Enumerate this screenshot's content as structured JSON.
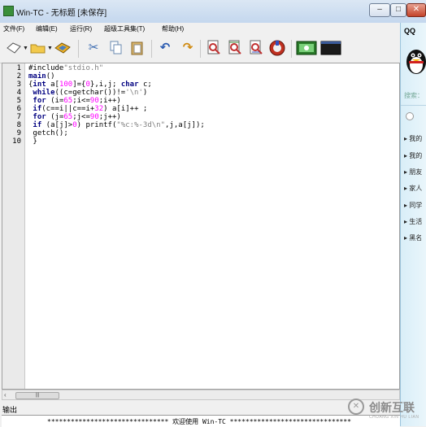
{
  "window": {
    "title": "Win-TC - 无标题 [未保存]",
    "controls": {
      "minimize": "–",
      "maximize": "□",
      "close": "✕"
    }
  },
  "menu": [
    "文件(F)",
    "编辑(E)",
    "运行(R)",
    "超级工具集(T)",
    "帮助(H)"
  ],
  "toolbar": {
    "icons": [
      "new-file-icon",
      "open-folder-icon",
      "save-disk-icon",
      "cut-icon",
      "copy-icon",
      "paste-icon",
      "undo-icon",
      "redo-icon",
      "find-icon",
      "find-next-icon",
      "replace-icon",
      "refresh-icon",
      "compile-icon",
      "console-icon"
    ],
    "console_label": "C:\\_"
  },
  "editor": {
    "line_numbers": [
      "1",
      "2",
      "3",
      "4",
      "5",
      "6",
      "7",
      "8",
      "9",
      "10"
    ],
    "code": [
      "#include\"stdio.h\"",
      "main()",
      "{int a[100]={0},i,j; char c;",
      " while((c=getchar())!='\\n')",
      " for (i=65;i<=90;i++)",
      " if(c==i||c==i+32) a[i]++ ;",
      " for (j=65;j<=90;j++)",
      " if (a[j]>0) printf(\"%c:%-3d\\n\",j,a[j]);",
      " getch();",
      " }"
    ],
    "colors": {
      "keyword": "#000080",
      "number": "#ff00ff",
      "string": "#808080",
      "default": "#000000"
    }
  },
  "scrollbar": {
    "left_arrow": "‹",
    "thumb_label": "|||"
  },
  "output": {
    "label": "输出",
    "text": "******************************* 欢迎使用 Win-TC *******************************"
  },
  "qq_panel": {
    "title": "QQ",
    "search_placeholder": "搜索：",
    "groups": [
      "▸ 我的",
      "▸ 我的",
      "▸ 朋友",
      "▸ 家人",
      "▸ 同学",
      "▸ 生活",
      "▸ 黑名"
    ]
  },
  "watermark": {
    "text": "创新互联",
    "sub": "CHUANG XIN HU LIAN"
  }
}
